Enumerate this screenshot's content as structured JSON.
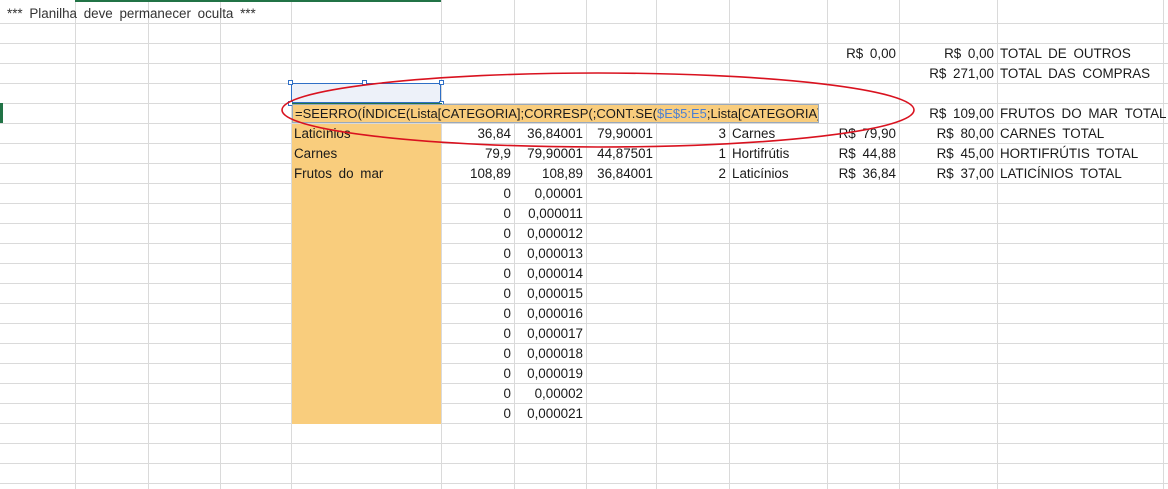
{
  "banner_note": "***   Planilha  deve  permanecer  oculta  ***",
  "totals": [
    {
      "a": "R$  0,00",
      "b": "R$  0,00",
      "label": "TOTAL  DE  OUTROS"
    },
    {
      "a": "",
      "b": "R$  271,00",
      "label": "TOTAL  DAS  COMPRAS"
    }
  ],
  "formula": {
    "part1": "=SEERRO(ÍNDICE(Lista[CATEGORIA];CORRESP(;CONT.SE(",
    "ref": "$E$5:E5",
    "part2": ";Lista[CATEGORIA]);));\"\")"
  },
  "formula_row_total": {
    "b": "R$  109,00",
    "label": "FRUTOS  DO  MAR  TOTAL"
  },
  "data_rows": [
    {
      "category": "Laticínios",
      "v1": "36,84",
      "v2": "36,84001",
      "v3": "79,90001",
      "rank": "3",
      "cat2": "Carnes",
      "price": "R$  79,90",
      "total": "R$  80,00",
      "label": "CARNES  TOTAL"
    },
    {
      "category": "Carnes",
      "v1": "79,9",
      "v2": "79,90001",
      "v3": "44,87501",
      "rank": "1",
      "cat2": "Hortifrútis",
      "price": "R$  44,88",
      "total": "R$  45,00",
      "label": "HORTIFRÚTIS  TOTAL"
    },
    {
      "category": "Frutos  do  mar",
      "v1": "108,89",
      "v2": "108,89",
      "v3": "36,84001",
      "rank": "2",
      "cat2": "Laticínios",
      "price": "R$  36,84",
      "total": "R$  37,00",
      "label": "LATICÍNIOS  TOTAL"
    }
  ],
  "zero_rows": [
    {
      "v1": "0",
      "v2": "0,00001"
    },
    {
      "v1": "0",
      "v2": "0,000011"
    },
    {
      "v1": "0",
      "v2": "0,000012"
    },
    {
      "v1": "0",
      "v2": "0,000013"
    },
    {
      "v1": "0",
      "v2": "0,000014"
    },
    {
      "v1": "0",
      "v2": "0,000015"
    },
    {
      "v1": "0",
      "v2": "0,000016"
    },
    {
      "v1": "0",
      "v2": "0,000017"
    },
    {
      "v1": "0",
      "v2": "0,000018"
    },
    {
      "v1": "0",
      "v2": "0,000019"
    },
    {
      "v1": "0",
      "v2": "0,00002"
    },
    {
      "v1": "0",
      "v2": "0,000021"
    }
  ],
  "colors": {
    "highlight_fill": "#f9cd7d",
    "annotation_ellipse": "#d9121f",
    "selection_border": "#2f6fc6",
    "active_marker": "#217346",
    "reference_text": "#4c7fd1"
  }
}
